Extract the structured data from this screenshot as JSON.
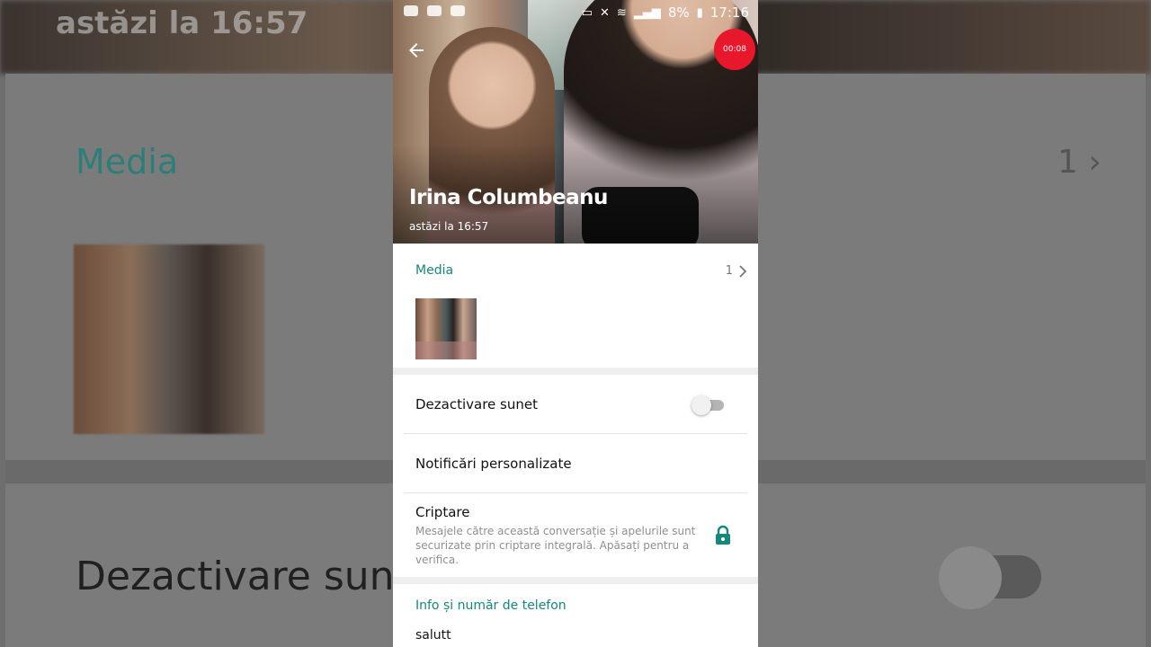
{
  "background": {
    "top_text": "astăzi la 16:57",
    "media_label": "Media",
    "media_count": "1",
    "mute_label": "Dezactivare sun"
  },
  "status_bar": {
    "battery": "8%",
    "time": "17:16"
  },
  "recorder": {
    "elapsed": "00:08"
  },
  "contact": {
    "name": "Irina Columbeanu",
    "last_seen": "astăzi la 16:57"
  },
  "media": {
    "title": "Media",
    "count": "1"
  },
  "settings": {
    "mute_label": "Dezactivare sunet",
    "mute_on": false,
    "custom_notifications_label": "Notificări personalizate",
    "encryption_label": "Criptare",
    "encryption_desc": "Mesajele către această conversație și apelurile sunt securizate prin criptare integrală. Apăsați pentru a verifica."
  },
  "info": {
    "title": "Info și număr de telefon",
    "status": "salutt"
  },
  "colors": {
    "accent": "#15877d",
    "record": "#e8172b"
  }
}
